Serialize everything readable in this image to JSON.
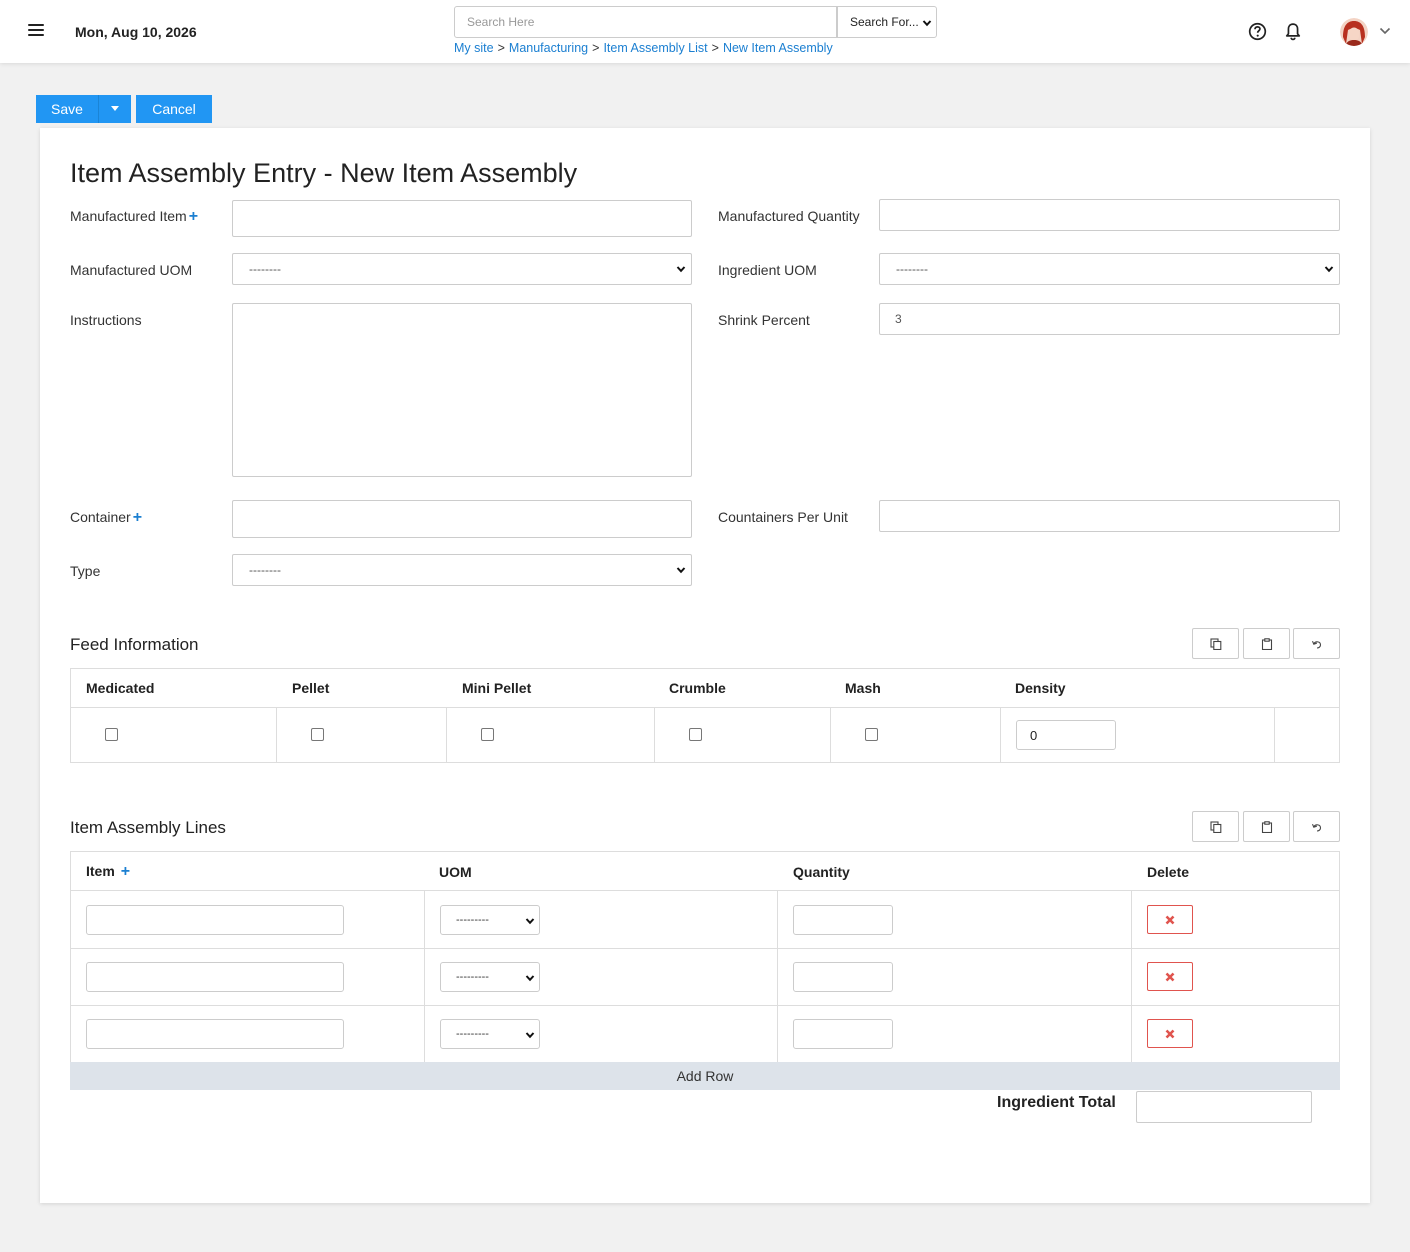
{
  "header": {
    "date": "Mon, Aug 10, 2026",
    "search_placeholder": "Search Here",
    "search_for": "Search For...",
    "breadcrumb": [
      "My site",
      "Manufacturing",
      "Item Assembly List",
      "New Item Assembly"
    ],
    "breadcrumb_sep": ">",
    "icons": [
      "menu-icon",
      "help-icon",
      "bell-icon",
      "avatar",
      "chevron-down-icon"
    ]
  },
  "actions": {
    "save": "Save",
    "cancel": "Cancel"
  },
  "form": {
    "title": "Item Assembly Entry - New Item Assembly",
    "plus": "+",
    "manufactured_item_label": "Manufactured Item",
    "manufactured_item_value": "",
    "manufactured_quantity_label": "Manufactured Quantity",
    "manufactured_quantity_value": "",
    "manufactured_uom_label": "Manufactured UOM",
    "manufactured_uom_value": "--------",
    "ingredient_uom_label": "Ingredient UOM",
    "ingredient_uom_value": "--------",
    "instructions_label": "Instructions",
    "instructions_value": "",
    "shrink_percent_label": "Shrink Percent",
    "shrink_percent_value": "3",
    "container_label": "Container",
    "container_value": "",
    "containers_per_unit_label": "Countainers Per Unit",
    "containers_per_unit_value": "",
    "type_label": "Type",
    "type_value": "--------"
  },
  "feed": {
    "title": "Feed Information",
    "columns": [
      "Medicated",
      "Pellet",
      "Mini Pellet",
      "Crumble",
      "Mash",
      "Density"
    ],
    "medicated": false,
    "pellet": false,
    "mini_pellet": false,
    "crumble": false,
    "mash": false,
    "density": "0"
  },
  "lines": {
    "title": "Item Assembly Lines",
    "columns": [
      "Item",
      "UOM",
      "Quantity",
      "Delete"
    ],
    "rows": [
      {
        "item": "",
        "uom": "---------",
        "quantity": ""
      },
      {
        "item": "",
        "uom": "---------",
        "quantity": ""
      },
      {
        "item": "",
        "uom": "---------",
        "quantity": ""
      }
    ],
    "add_row": "Add Row",
    "ingredient_total_label": "Ingredient Total",
    "ingredient_total_value": ""
  },
  "colors": {
    "accent": "#2196f3",
    "link": "#1b7fd1",
    "danger": "#e0544e",
    "add_row_bg": "#dde3ea"
  }
}
